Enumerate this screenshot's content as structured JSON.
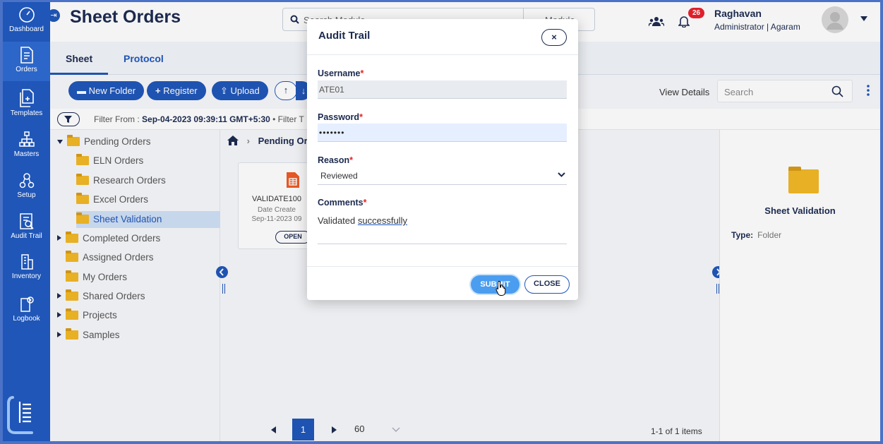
{
  "sidebar": {
    "items": [
      {
        "label": "Dashboard",
        "icon": "dashboard-icon"
      },
      {
        "label": "Orders",
        "icon": "orders-icon"
      },
      {
        "label": "Templates",
        "icon": "templates-icon"
      },
      {
        "label": "Masters",
        "icon": "masters-icon"
      },
      {
        "label": "Setup",
        "icon": "setup-icon"
      },
      {
        "label": "Audit Trail",
        "icon": "audit-trail-icon"
      },
      {
        "label": "Inventory",
        "icon": "inventory-icon"
      },
      {
        "label": "Logbook",
        "icon": "logbook-icon"
      }
    ]
  },
  "header": {
    "title": "Sheet Orders",
    "search_placeholder": "Search Module",
    "module_label": "Module",
    "notification_count": "26",
    "user_name": "Raghavan",
    "user_role": "Administrator | Agaram"
  },
  "tabs": [
    {
      "label": "Sheet"
    },
    {
      "label": "Protocol"
    }
  ],
  "toolbar": {
    "new_folder": "New Folder",
    "register": "Register",
    "upload": "Upload",
    "view_details": "View Details",
    "search_placeholder": "Search"
  },
  "filter": {
    "prefix": "Filter From :",
    "from_value": "Sep-04-2023 09:39:11 GMT+5:30",
    "suffix": "• Filter T"
  },
  "tree": {
    "items": [
      {
        "label": "Pending Orders"
      },
      {
        "label": "ELN Orders"
      },
      {
        "label": "Research Orders"
      },
      {
        "label": "Excel Orders"
      },
      {
        "label": "Sheet Validation"
      },
      {
        "label": "Completed Orders"
      },
      {
        "label": "Assigned Orders"
      },
      {
        "label": "My Orders"
      },
      {
        "label": "Shared Orders"
      },
      {
        "label": "Projects"
      },
      {
        "label": "Samples"
      }
    ]
  },
  "middle": {
    "breadcrumb": "Pending Or",
    "card": {
      "name": "VALIDATE100",
      "created_label": "Date Create",
      "created_date": "Sep-11-2023 09",
      "open_label": "OPEN"
    },
    "pager": {
      "current_page": "1",
      "per_page": "60",
      "items_count": "1-1 of 1 items"
    }
  },
  "right_panel": {
    "title": "Sheet Validation",
    "type_label": "Type:",
    "type_value": "Folder"
  },
  "modal": {
    "title": "Audit Trail",
    "close_glyph": "×",
    "username_label": "Username",
    "username_value": "ATE01",
    "password_label": "Password",
    "password_value": "•••••••",
    "reason_label": "Reason",
    "reason_value": "Reviewed",
    "comments_label": "Comments",
    "comments_value_1": "Validated",
    "comments_value_2": "successfully",
    "required_marker": "*",
    "submit_label": "SUBMIT",
    "close_label": "CLOSE"
  },
  "colors": {
    "primary": "#1f56b8",
    "title": "#1b2a4e",
    "submit": "#4b9df0",
    "badge": "#e9202a",
    "folder": "#f2b824"
  }
}
